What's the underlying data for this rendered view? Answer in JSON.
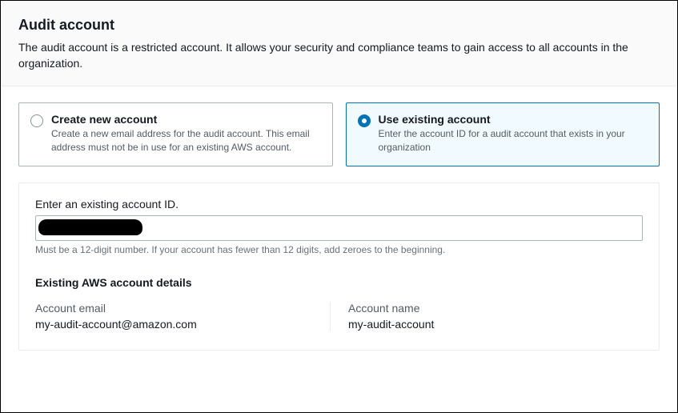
{
  "header": {
    "title": "Audit account",
    "description": "The audit account is a restricted account. It allows your security and compliance teams to gain access to all accounts in the organization."
  },
  "options": {
    "create": {
      "title": "Create new account",
      "desc": "Create a new email address for the audit account. This email address must not be in use for an existing AWS account."
    },
    "existing": {
      "title": "Use existing account",
      "desc": "Enter the account ID for a audit account that exists in your organization"
    }
  },
  "form": {
    "account_id_label": "Enter an existing account ID.",
    "account_id_value": "",
    "account_id_hint": "Must be a 12-digit number. If your account has fewer than 12 digits, add zeroes to the beginning."
  },
  "details": {
    "section_title": "Existing AWS account details",
    "email_label": "Account email",
    "email_value": "my-audit-account@amazon.com",
    "name_label": "Account name",
    "name_value": "my-audit-account"
  }
}
